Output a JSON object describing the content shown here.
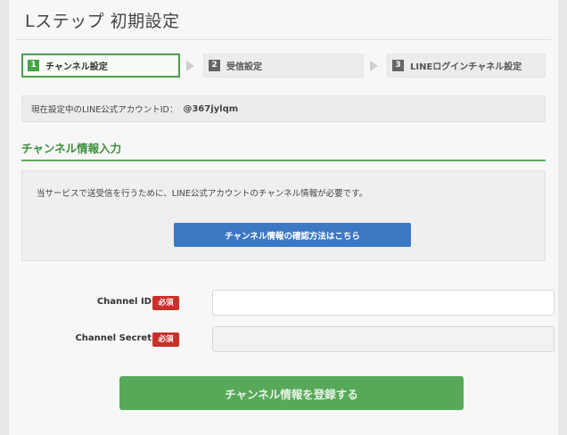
{
  "header": {
    "title": "Lステップ 初期設定"
  },
  "steps": [
    {
      "num": "1",
      "label": "チャンネル設定",
      "active": true
    },
    {
      "num": "2",
      "label": "受信設定",
      "active": false
    },
    {
      "num": "3",
      "label": "LINEログインチャネル設定",
      "active": false
    }
  ],
  "account": {
    "label": "現在設定中のLINE公式アカウントID：",
    "id": "@367jylqm"
  },
  "section": {
    "title": "チャンネル情報入力",
    "notice": "当サービスで送受信を行うために、LINE公式アカウントのチャンネル情報が必要です。",
    "help_button": "チャンネル情報の確認方法はこちら"
  },
  "form": {
    "required_badge": "必須",
    "channel_id": {
      "label": "Channel ID",
      "value": "",
      "placeholder": ""
    },
    "channel_secret": {
      "label": "Channel Secret",
      "value": "",
      "placeholder": ""
    }
  },
  "submit_label": "チャンネル情報を登録する",
  "colors": {
    "accent": "#47a348",
    "primary": "#3c78c4",
    "required": "#c9302c"
  }
}
